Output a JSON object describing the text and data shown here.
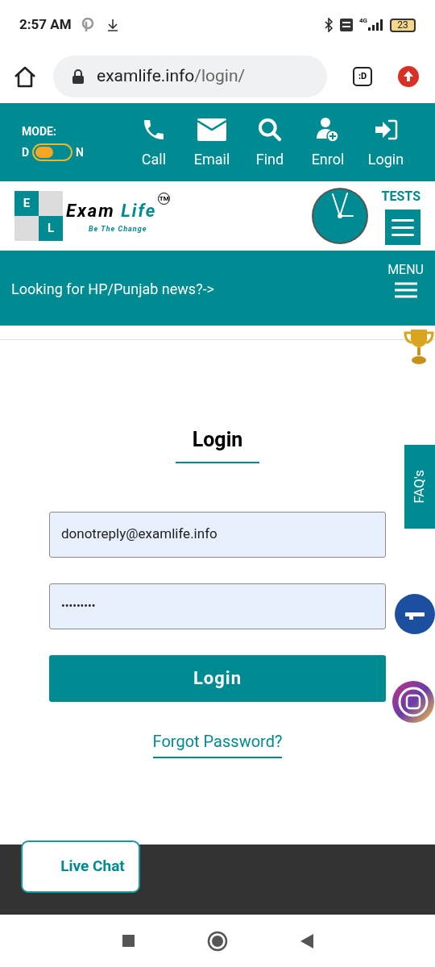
{
  "status_bar": {
    "time": "2:57 AM",
    "network": "4G",
    "battery": "23"
  },
  "browser": {
    "url_host": "examlife.info",
    "url_path": "/login/",
    "tab_badge": ":D"
  },
  "top_bar": {
    "mode": {
      "label": "MODE:",
      "left": "D",
      "right": "N",
      "night": false
    },
    "actions": [
      {
        "kind": "call",
        "label": "Call"
      },
      {
        "kind": "email",
        "label": "Email"
      },
      {
        "kind": "find",
        "label": "Find"
      },
      {
        "kind": "enrol",
        "label": "Enrol"
      },
      {
        "kind": "login",
        "label": "Login"
      }
    ]
  },
  "logo": {
    "tiles": [
      "E",
      "L"
    ],
    "word1": "Exam",
    "word2": "Life",
    "tagline": "Be The Change",
    "mark": "TM"
  },
  "tests_label": "TESTS",
  "news_bar": {
    "text": "Looking for HP/Punjab news?->",
    "menu_label": "MENU"
  },
  "login": {
    "title": "Login",
    "email": "donotreply@examlife.info",
    "password": "•••••••••",
    "button": "Login",
    "forgot": "Forgot Password?"
  },
  "faq_tab": "FAQ's",
  "live_chat": "Live Chat"
}
